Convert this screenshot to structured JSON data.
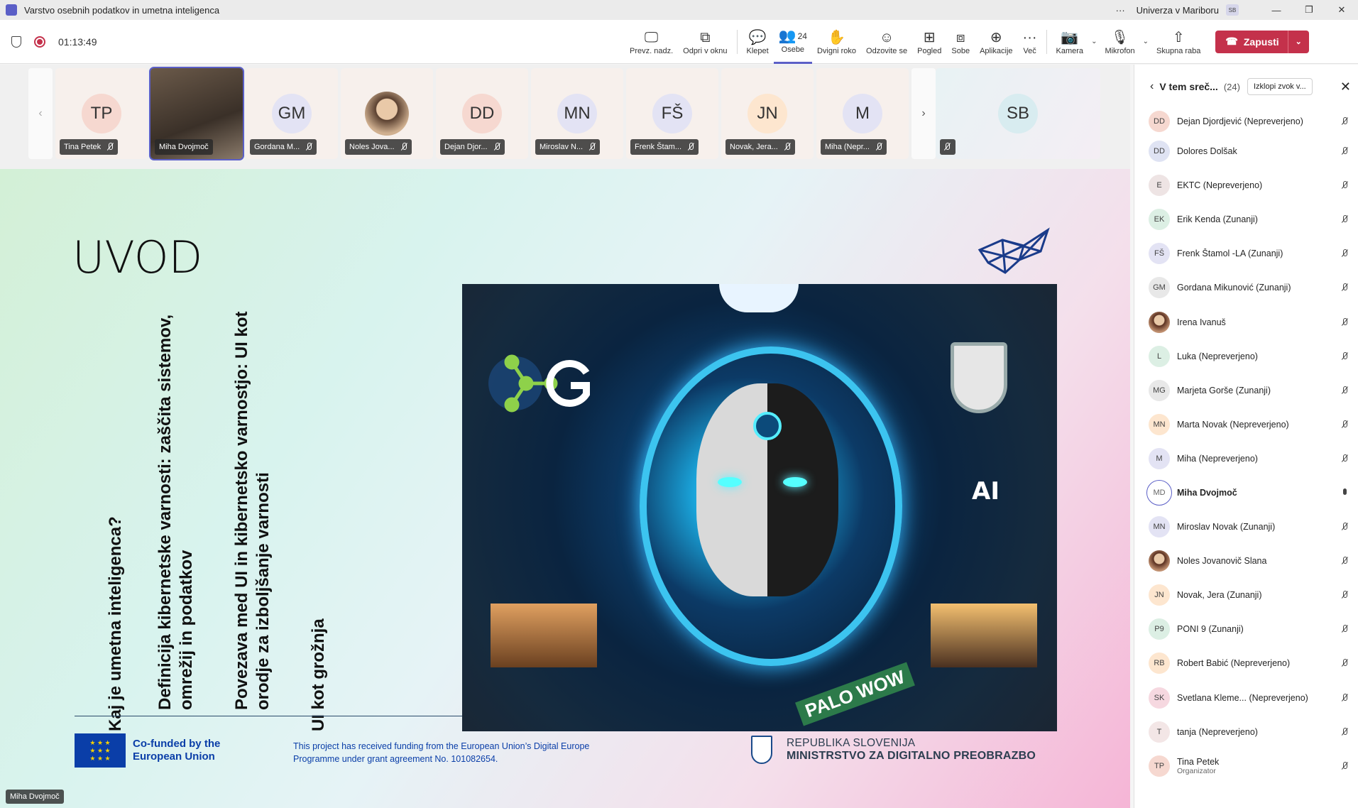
{
  "window": {
    "title": "Varstvo osebnih podatkov in umetna inteligenca",
    "more": "···",
    "org": "Univerza v Mariboru",
    "org_badge": "SB",
    "minimize": "—",
    "restore": "❐",
    "close": "✕"
  },
  "toolbar": {
    "timer": "01:13:49",
    "buttons": [
      {
        "label": "Prevz. nadz.",
        "icon": "🖵"
      },
      {
        "label": "Odpri v oknu",
        "icon": "⧉"
      },
      {
        "label": "Klepet",
        "icon": "💬"
      },
      {
        "label": "Osebe",
        "icon": "👥",
        "count": "24"
      },
      {
        "label": "Dvigni roko",
        "icon": "✋"
      },
      {
        "label": "Odzovite se",
        "icon": "☺"
      },
      {
        "label": "Pogled",
        "icon": "⊞"
      },
      {
        "label": "Sobe",
        "icon": "⧈"
      },
      {
        "label": "Aplikacije",
        "icon": "⊕"
      },
      {
        "label": "Več",
        "icon": "···"
      },
      {
        "label": "Kamera",
        "icon": "📷"
      },
      {
        "label": "Mikrofon",
        "icon": "🎙"
      },
      {
        "label": "Skupna raba",
        "icon": "⇧"
      }
    ],
    "leave_label": "Zapusti",
    "leave_icon": "☎",
    "dropdown": "⌄"
  },
  "strip": {
    "prev": "‹",
    "next": "›",
    "tiles": [
      {
        "initials": "TP",
        "name": "Tina Petek",
        "bg": "#f6d8d0"
      },
      {
        "initials": "",
        "name": "Miha Dvojmoč",
        "bg": "photo"
      },
      {
        "initials": "GM",
        "name": "Gordana M...",
        "bg": "#e3e3f4"
      },
      {
        "initials": "",
        "name": "Noles Jova...",
        "bg": "photo"
      },
      {
        "initials": "DD",
        "name": "Dejan Djor...",
        "bg": "#f6d8d0"
      },
      {
        "initials": "MN",
        "name": "Miroslav N...",
        "bg": "#e3e3f4"
      },
      {
        "initials": "FŠ",
        "name": "Frenk Štam...",
        "bg": "#e3e3f4"
      },
      {
        "initials": "JN",
        "name": "Novak, Jera...",
        "bg": "#fde6cf"
      },
      {
        "initials": "M",
        "name": "Miha (Nepr...",
        "bg": "#e3e3f4"
      }
    ],
    "share_initials": "SB"
  },
  "slide": {
    "title": "UVOD",
    "bullets": [
      "Kaj je umetna inteligenca?",
      "Definicija kibernetske varnosti: zaščita sistemov,\nomrežij in podatkov",
      "Povezava med UI in kibernetsko varnostjo: UI kot\norodje za izboljšanje varnosti",
      "UI kot grožnja"
    ],
    "image_text_ai": "AI",
    "image_text_banner": "PALO WOW",
    "eu_text": "Co-funded by the European Union",
    "funding_text": "This project has received funding from the European Union’s Digital Europe Programme under grant agreement No. 101082654.",
    "ministry_line1": "REPUBLIKA SLOVENIJA",
    "ministry_line2": "MINISTRSTVO ZA DIGITALNO PREOBRAZBO",
    "speaker_label": "Miha Dvojmoč"
  },
  "panel": {
    "title": "V tem sreč...",
    "count": "(24)",
    "mute_all": "Izklopi zvok v...",
    "back": "‹",
    "close": "✕",
    "participants": [
      {
        "initials": "DD",
        "name": "Dejan Djordjević (Nepreverjeno)",
        "bg": "#f6d8d0",
        "mic": "off"
      },
      {
        "initials": "DD",
        "name": "Dolores Dolšak",
        "bg": "#dfe3f3",
        "mic": "off"
      },
      {
        "initials": "E",
        "name": "EKTC (Nepreverjeno)",
        "bg": "#eee4e4",
        "mic": "off"
      },
      {
        "initials": "EK",
        "name": "Erik Kenda (Zunanji)",
        "bg": "#dcefe4",
        "mic": "off"
      },
      {
        "initials": "FŠ",
        "name": "Frenk Štamol -LA (Zunanji)",
        "bg": "#e3e3f4",
        "mic": "off"
      },
      {
        "initials": "GM",
        "name": "Gordana Mikunović (Zunanji)",
        "bg": "#e8e8e8",
        "mic": "off"
      },
      {
        "initials": "",
        "name": "Irena Ivanuš",
        "bg": "photo",
        "mic": "off"
      },
      {
        "initials": "L",
        "name": "Luka (Nepreverjeno)",
        "bg": "#dcefe4",
        "mic": "off"
      },
      {
        "initials": "MG",
        "name": "Marjeta Gorše (Zunanji)",
        "bg": "#e8e8e8",
        "mic": "off"
      },
      {
        "initials": "MN",
        "name": "Marta Novak (Nepreverjeno)",
        "bg": "#fde6cf",
        "mic": "off"
      },
      {
        "initials": "M",
        "name": "Miha (Nepreverjeno)",
        "bg": "#e3e3f4",
        "mic": "off"
      },
      {
        "initials": "MD",
        "name": "Miha Dvojmoč",
        "bg": "me",
        "mic": "on"
      },
      {
        "initials": "MN",
        "name": "Miroslav Novak (Zunanji)",
        "bg": "#e3e3f4",
        "mic": "off"
      },
      {
        "initials": "",
        "name": "Noles Jovanovič Slana",
        "bg": "photo",
        "mic": "off"
      },
      {
        "initials": "JN",
        "name": "Novak, Jera (Zunanji)",
        "bg": "#fde6cf",
        "mic": "off"
      },
      {
        "initials": "P9",
        "name": "PONI 9 (Zunanji)",
        "bg": "#dcefe4",
        "mic": "off"
      },
      {
        "initials": "RB",
        "name": "Robert Babić (Nepreverjeno)",
        "bg": "#fde6cf",
        "mic": "off"
      },
      {
        "initials": "SK",
        "name": "Svetlana Kleme... (Nepreverjeno)",
        "bg": "#f6d8e0",
        "mic": "off"
      },
      {
        "initials": "T",
        "name": "tanja (Nepreverjeno)",
        "bg": "#f3e6e6",
        "mic": "off"
      },
      {
        "initials": "TP",
        "name": "Tina Petek",
        "sub": "Organizator",
        "bg": "#f6d8d0",
        "mic": "off"
      }
    ]
  }
}
